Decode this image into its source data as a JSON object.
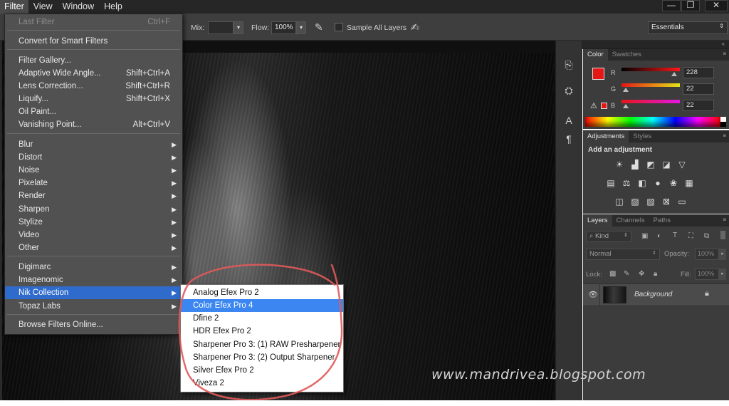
{
  "menubar": {
    "items": [
      "Filter",
      "View",
      "Window",
      "Help"
    ],
    "active_item": "Filter",
    "window_controls": [
      "minimize-icon",
      "restore-icon",
      "close-icon"
    ]
  },
  "options_bar": {
    "mix_label": "Mix:",
    "mix_value": "",
    "flow_label": "Flow:",
    "flow_value": "100%",
    "sample_all_layers_label": "Sample All Layers",
    "sample_all_layers_checked": false,
    "workspace": "Essentials"
  },
  "filter_menu": {
    "items": [
      {
        "label": "Last Filter",
        "shortcut": "Ctrl+F",
        "disabled": true
      },
      {
        "label": "Convert for Smart Filters"
      },
      {
        "label": "Filter Gallery..."
      },
      {
        "label": "Adaptive Wide Angle...",
        "shortcut": "Shift+Ctrl+A"
      },
      {
        "label": "Lens Correction...",
        "shortcut": "Shift+Ctrl+R"
      },
      {
        "label": "Liquify...",
        "shortcut": "Shift+Ctrl+X"
      },
      {
        "label": "Oil Paint..."
      },
      {
        "label": "Vanishing Point...",
        "shortcut": "Alt+Ctrl+V"
      },
      {
        "label": "Blur",
        "submenu": true
      },
      {
        "label": "Distort",
        "submenu": true
      },
      {
        "label": "Noise",
        "submenu": true
      },
      {
        "label": "Pixelate",
        "submenu": true
      },
      {
        "label": "Render",
        "submenu": true
      },
      {
        "label": "Sharpen",
        "submenu": true
      },
      {
        "label": "Stylize",
        "submenu": true
      },
      {
        "label": "Video",
        "submenu": true
      },
      {
        "label": "Other",
        "submenu": true
      },
      {
        "label": "Digimarc",
        "submenu": true
      },
      {
        "label": "Imagenomic",
        "submenu": true
      },
      {
        "label": "Nik Collection",
        "submenu": true,
        "highlighted": true
      },
      {
        "label": "Topaz Labs",
        "submenu": true
      },
      {
        "label": "Browse Filters Online..."
      }
    ]
  },
  "nik_submenu": {
    "items": [
      {
        "label": "Analog Efex Pro 2"
      },
      {
        "label": "Color Efex Pro 4",
        "highlighted": true
      },
      {
        "label": "Dfine 2"
      },
      {
        "label": "HDR Efex Pro 2"
      },
      {
        "label": "Sharpener Pro 3: (1) RAW Presharpener"
      },
      {
        "label": "Sharpener Pro 3: (2) Output Sharpener"
      },
      {
        "label": "Silver Efex Pro 2"
      },
      {
        "label": "Viveza 2"
      }
    ]
  },
  "color_panel": {
    "tabs": [
      "Color",
      "Swatches"
    ],
    "active_tab": "Color",
    "foreground_color": "#e41616",
    "background_color": "#ffffff",
    "channels": [
      {
        "label": "R",
        "value": "228"
      },
      {
        "label": "G",
        "value": "22"
      },
      {
        "label": "B",
        "value": "22"
      }
    ]
  },
  "adjustments_panel": {
    "tabs": [
      "Adjustments",
      "Styles"
    ],
    "active_tab": "Adjustments",
    "heading": "Add an adjustment",
    "icons": [
      [
        "brightness-contrast-icon",
        "levels-icon",
        "curves-icon",
        "exposure-icon",
        "vibrance-icon"
      ],
      [
        "hue-saturation-icon",
        "color-balance-icon",
        "black-white-icon",
        "photo-filter-icon",
        "channel-mixer-icon",
        "color-lookup-icon"
      ],
      [
        "invert-icon",
        "posterize-icon",
        "threshold-icon",
        "selective-color-icon",
        "gradient-map-icon"
      ]
    ]
  },
  "layers_panel": {
    "tabs": [
      "Layers",
      "Channels",
      "Paths"
    ],
    "active_tab": "Layers",
    "filter_kind_label": "Kind",
    "blend_mode": "Normal",
    "opacity_label": "Opacity:",
    "opacity_value": "100%",
    "lock_label": "Lock:",
    "fill_label": "Fill:",
    "fill_value": "100%",
    "layers": [
      {
        "name": "Background",
        "visible": true,
        "locked": true
      }
    ]
  },
  "watermark": "www.mandrivea.blogspot.com",
  "colors": {
    "menu_highlight": "#2f6bcc",
    "submenu_highlight": "#3b86f1",
    "annotation_circle": "#e05a5a"
  }
}
